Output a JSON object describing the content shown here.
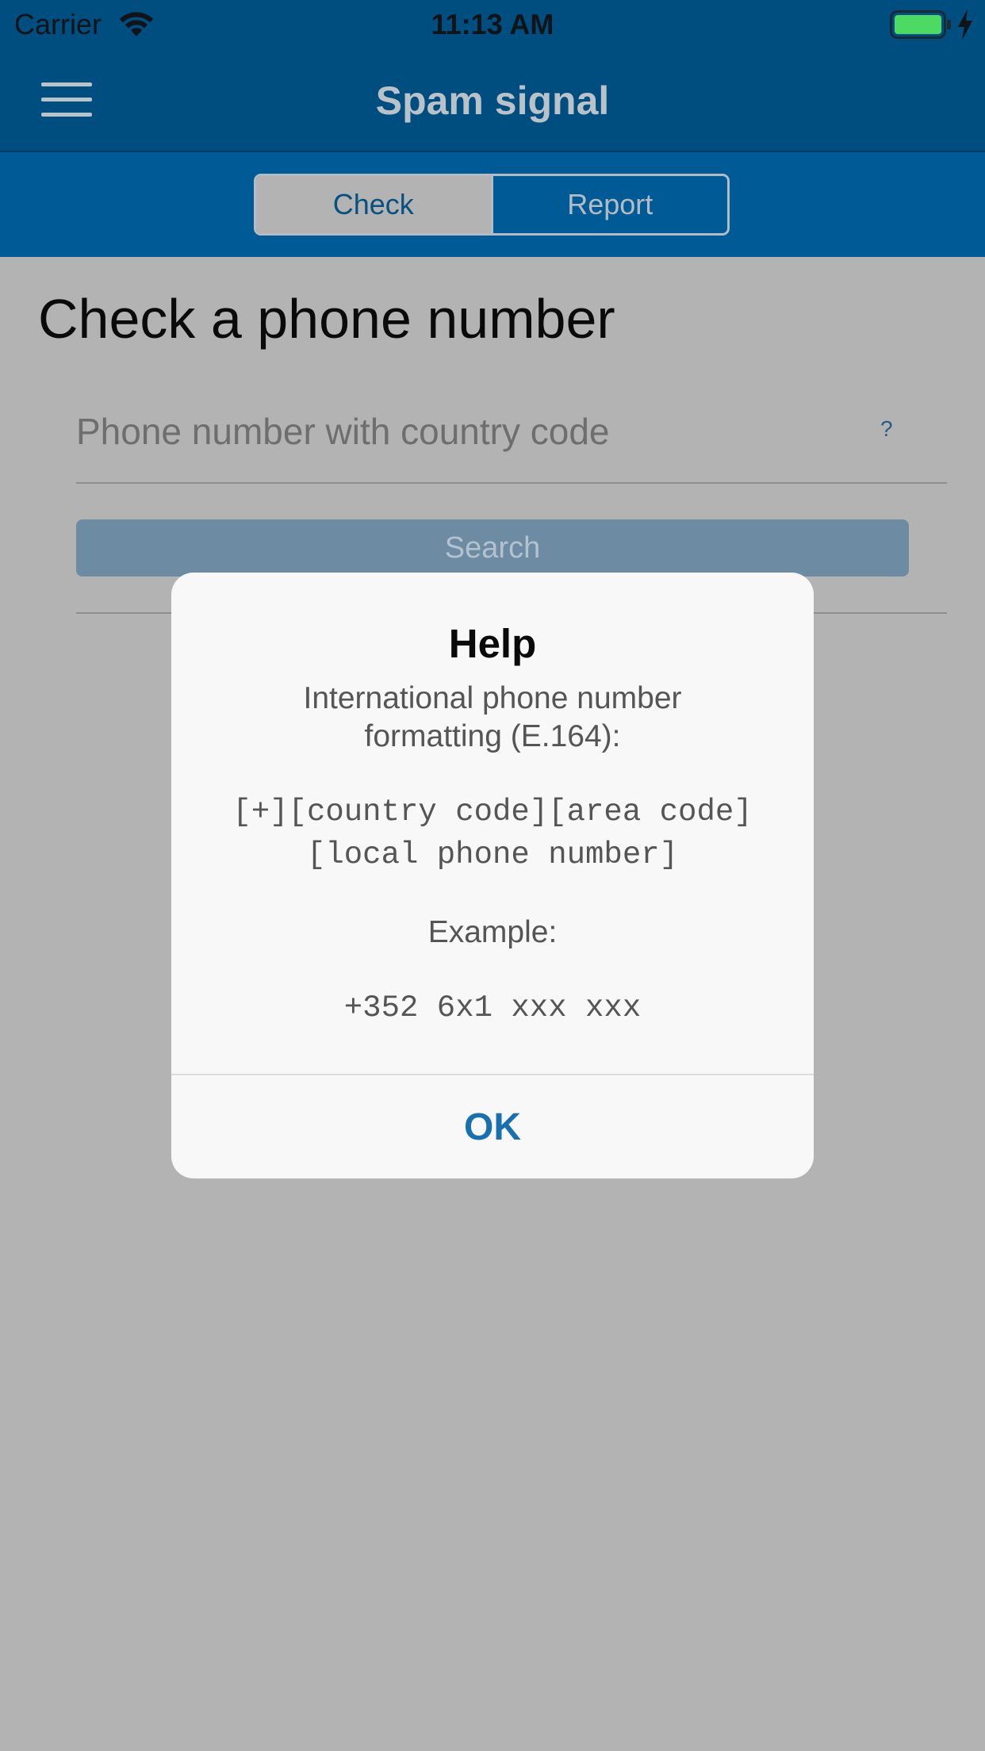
{
  "status_bar": {
    "carrier": "Carrier",
    "time": "11:13 AM",
    "battery_color": "#4cd964"
  },
  "nav": {
    "title": "Spam signal",
    "background": "#004d80"
  },
  "segments": {
    "check": "Check",
    "report": "Report",
    "selected": "Check"
  },
  "page": {
    "title": "Check a phone number",
    "phone_placeholder": "Phone number with country code",
    "phone_value": "",
    "help_label": "?",
    "search_label": "Search"
  },
  "dialog": {
    "title": "Help",
    "intro": "International phone number formatting (E.164):",
    "format_line1": "[+][country code][area code]",
    "format_line2": "[local phone number]",
    "example_label": "Example:",
    "example_value": "+352 6x1 xxx xxx",
    "ok_label": "OK",
    "accent": "#1a6fb0"
  }
}
